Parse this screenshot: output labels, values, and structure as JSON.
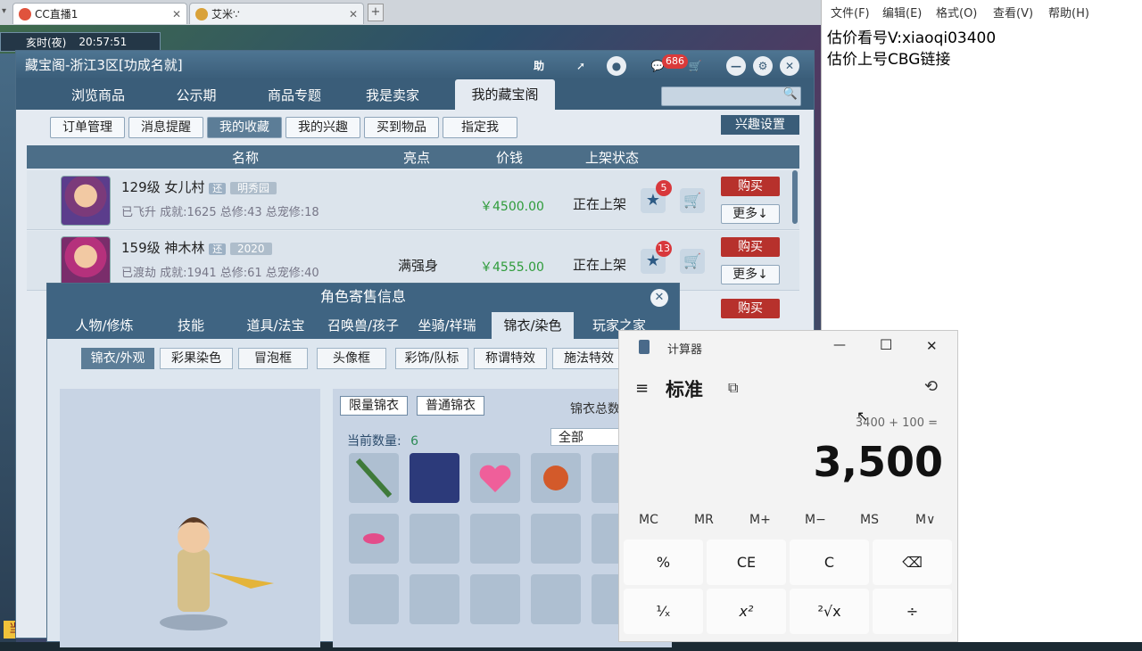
{
  "browser": {
    "tabs": [
      {
        "label": "CC直播1"
      },
      {
        "label": "艾米∵"
      }
    ],
    "close": "✕",
    "new_tab": "+"
  },
  "hud": {
    "mode": "亥时(夜)",
    "time": "20:57:51"
  },
  "cbg": {
    "title": "藏宝阁-浙江3区[功成名就]",
    "title_icons": {
      "help": "助",
      "chat_badge": "686"
    },
    "nav_tabs": [
      "浏览商品",
      "公示期",
      "商品专题",
      "我是卖家",
      "我的藏宝阁"
    ],
    "sub_buttons": [
      "订单管理",
      "消息提醒",
      "我的收藏",
      "我的兴趣",
      "买到物品",
      "指定我"
    ],
    "interest_settings": "兴趣设置",
    "table_headers": [
      "名称",
      "亮点",
      "价钱",
      "上架状态"
    ],
    "rows": [
      {
        "level": "129级",
        "school": "女儿村",
        "tag": "还",
        "server": "明秀园",
        "detail": "已飞升 成就:1625 总修:43 总宠修:18",
        "highlight": "",
        "price": "￥4500.00",
        "status": "正在上架",
        "fav": "5",
        "buy": "购买",
        "more": "更多↓"
      },
      {
        "level": "159级",
        "school": "神木林",
        "tag": "还",
        "server": "2020",
        "detail": "已渡劫 成就:1941 总修:61 总宠修:40",
        "highlight": "满强身",
        "price": "￥4555.00",
        "status": "正在上架",
        "fav": "13",
        "buy": "购买",
        "more": "更多↓"
      }
    ],
    "third_row_buy": "购买"
  },
  "popup": {
    "title": "角色寄售信息",
    "close": "✕",
    "tabs": [
      "人物/修炼",
      "技能",
      "道具/法宝",
      "召唤兽/孩子",
      "坐骑/祥瑞",
      "锦衣/染色",
      "玩家之家"
    ],
    "subtabs": [
      "锦衣/外观",
      "彩果染色",
      "冒泡框",
      "头像框",
      "彩饰/队标",
      "称谓特效",
      "施法特效"
    ],
    "chips": [
      "限量锦衣",
      "普通锦衣"
    ],
    "summary_label": "锦衣总数",
    "count_label": "当前数量:",
    "count_value": "6",
    "filter": "全部"
  },
  "left_bottom": "当前",
  "calculator": {
    "app_title": "计算器",
    "mode": "标准",
    "expression": "3400 + 100 =",
    "result": "3,500",
    "memory": [
      "MC",
      "MR",
      "M+",
      "M−",
      "MS",
      "M∨"
    ],
    "keys": [
      "%",
      "CE",
      "C",
      "⌫",
      "¹⁄ₓ",
      "x²",
      "²√x",
      "÷"
    ],
    "window_controls": [
      "—",
      "☐",
      "✕"
    ]
  },
  "notepad": {
    "menu": [
      "文件(F)",
      "编辑(E)",
      "格式(O)",
      "查看(V)",
      "帮助(H)"
    ],
    "lines": [
      "估价看号V:xiaoqi03400",
      "估价上号CBG链接"
    ]
  }
}
